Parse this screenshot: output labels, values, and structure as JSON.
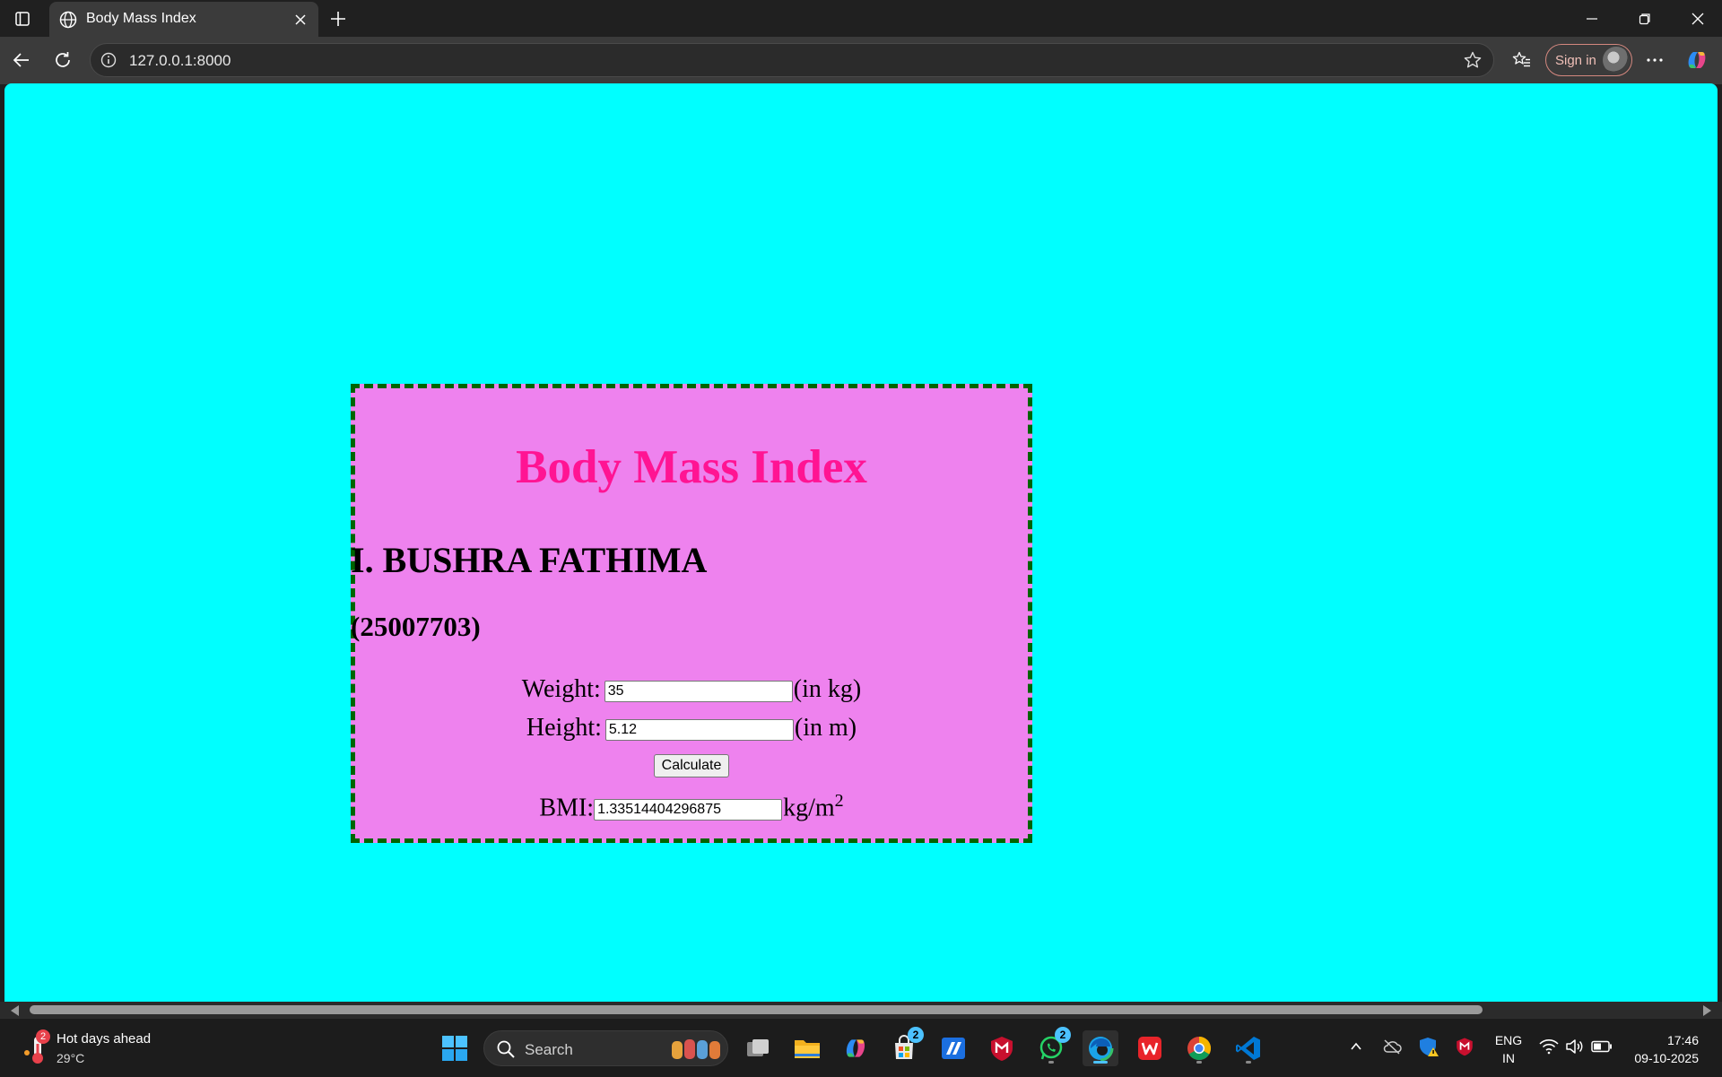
{
  "browser": {
    "tab_title": "Body Mass Index",
    "url": "127.0.0.1:8000",
    "sign_in_label": "Sign in",
    "icons": [
      "tab-actions-icon",
      "globe-icon",
      "close-icon",
      "plus-icon",
      "back-icon",
      "refresh-icon",
      "info-icon",
      "star-icon",
      "favorites-icon",
      "more-icon",
      "copilot-icon"
    ]
  },
  "page": {
    "background": "#00ffff",
    "card_background": "#ee82ee",
    "card_border_color": "#006400",
    "heading": "Body Mass Index",
    "heading_color": "#ff1493",
    "student_name": "I. BUSHRA FATHIMA",
    "student_id": "(25007703)",
    "weight_label": "Weight:",
    "weight_value": "35",
    "weight_unit": "(in kg)",
    "height_label": "Height:",
    "height_value": "5.12",
    "height_unit": "(in m)",
    "calculate_label": "Calculate",
    "bmi_label": "BMI:",
    "bmi_value": "1.33514404296875",
    "bmi_unit": "kg/m",
    "bmi_unit_sup": "2"
  },
  "taskbar": {
    "weather_title": "Hot days ahead",
    "weather_temp": "29°C",
    "weather_badge": "2",
    "search_label": "Search",
    "store_badge": "2",
    "whatsapp_badge": "2",
    "lang_line1": "ENG",
    "lang_line2": "IN",
    "time": "17:46",
    "date": "09-10-2025"
  }
}
